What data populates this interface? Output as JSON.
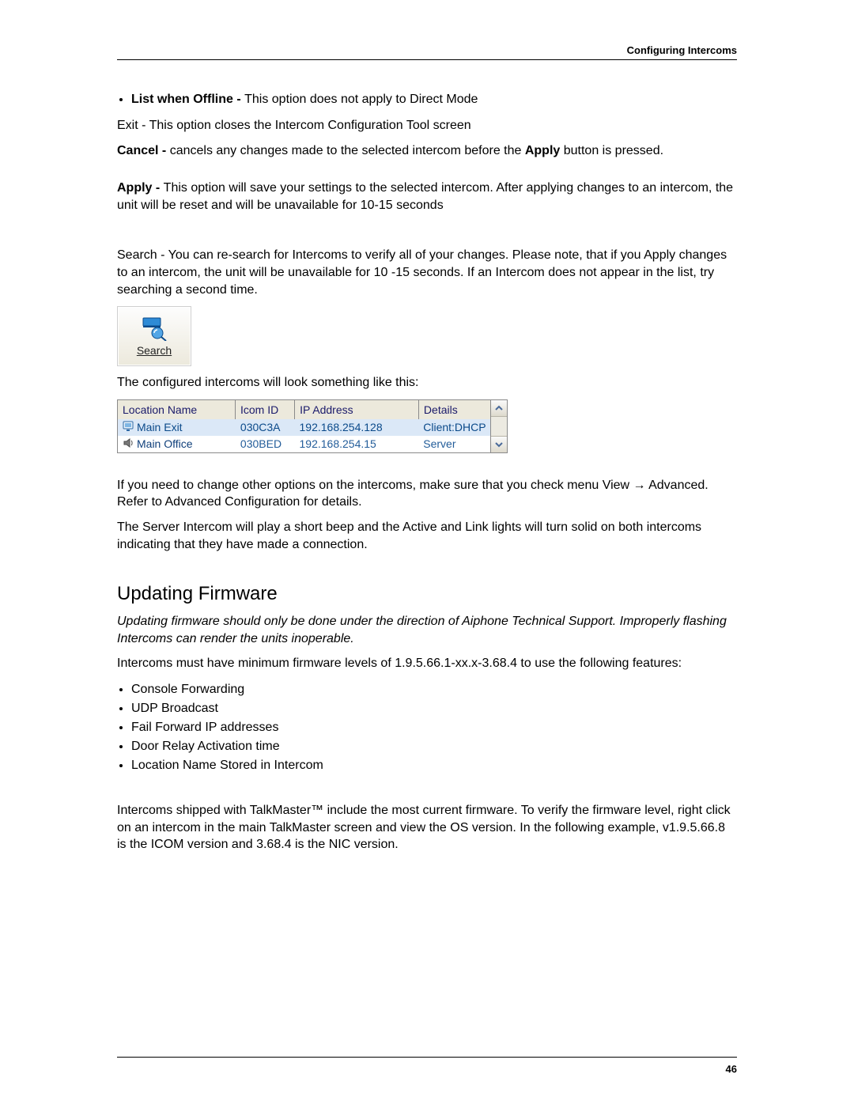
{
  "header": {
    "right": "Configuring Intercoms"
  },
  "footer": {
    "page": "46"
  },
  "bullets_top": {
    "list_offline": {
      "bold": "List when Offline - ",
      "text": "This option does not apply to Direct Mode"
    }
  },
  "exit_line": "Exit - This option closes the Intercom Configuration Tool screen",
  "cancel_line": {
    "bold1": "Cancel - ",
    "mid": "cancels any changes made to the selected intercom before the ",
    "bold2": "Apply",
    "tail": " button is pressed."
  },
  "apply_line": {
    "bold": "Apply - ",
    "text": "This option will save your settings to the selected intercom.  After applying changes to an intercom, the unit will be reset and will be unavailable for 10-15 seconds"
  },
  "search_para": "Search - You can re-search for Intercoms to verify all of your changes.  Please note, that if you Apply changes to an intercom, the unit will be unavailable for 10 -15 seconds.  If an Intercom does not appear in the list, try searching a second time.",
  "search_btn": {
    "label": "Search"
  },
  "configured_line": "The configured intercoms will look something like this:",
  "table": {
    "headers": [
      "Location Name",
      "Icom ID",
      "IP Address",
      "Details"
    ],
    "rows": [
      {
        "name": "Main Exit",
        "icom": "030C3A",
        "ip": "192.168.254.128",
        "details": "Client:DHCP",
        "selected": true,
        "icon": "monitor"
      },
      {
        "name": "Main Office",
        "icom": "030BED",
        "ip": "192.168.254.15",
        "details": "Server",
        "selected": false,
        "icon": "speaker"
      }
    ]
  },
  "post_table_1": "If you need to change other options on the intercoms, make sure that you check menu View → Advanced.  Refer to Advanced Configuration for details.",
  "post_table_2": "The Server Intercom will play a short beep and the Active and Link lights will turn solid on both intercoms indicating that they have made a connection.",
  "section_heading": "Updating Firmware",
  "warning_italic": "Updating firmware should only be done under the direction of Aiphone Technical Support.  Improperly flashing Intercoms can render the units inoperable.",
  "min_fw": "Intercoms must have minimum firmware levels of 1.9.5.66.1-xx.x-3.68.4 to use the following features:",
  "features": [
    "Console Forwarding",
    "UDP Broadcast",
    "Fail Forward IP addresses",
    "Door Relay Activation time",
    "Location Name Stored in Intercom"
  ],
  "shipping_para": "Intercoms shipped with TalkMaster™ include the most current firmware.  To verify the firmware level, right click on an intercom in the main TalkMaster screen and view the OS version.  In the following example, v1.9.5.66.8 is the ICOM version and 3.68.4 is the NIC version."
}
